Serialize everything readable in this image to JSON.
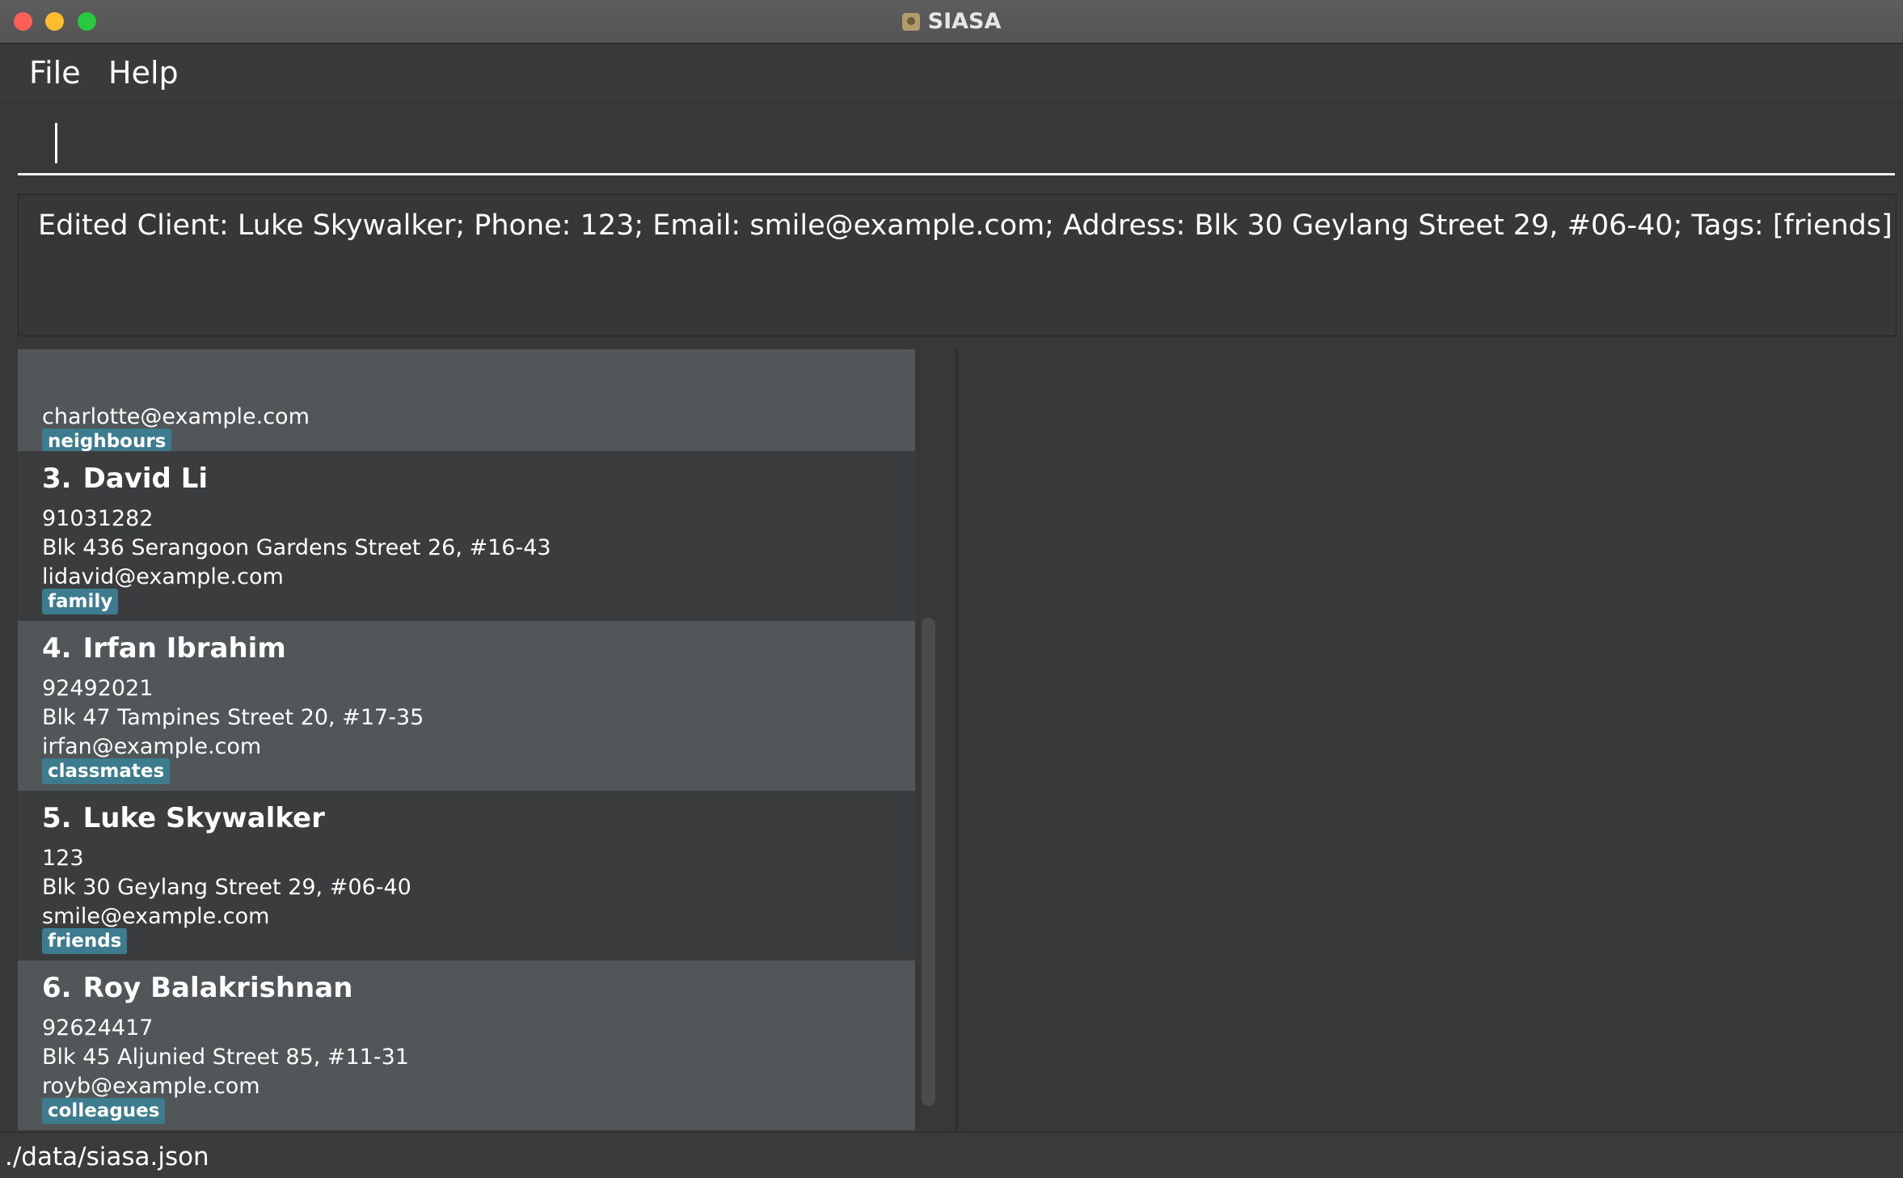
{
  "window": {
    "title": "SIASA",
    "icon": "app-icon"
  },
  "menu": {
    "file_label": "File",
    "help_label": "Help"
  },
  "command_box": {
    "value": "",
    "placeholder": ""
  },
  "result": {
    "text": "Edited Client: Luke Skywalker; Phone: 123; Email: smile@example.com; Address: Blk 30 Geylang Street 29, #06-40; Tags: [friends]"
  },
  "clients": [
    {
      "index": "",
      "name": "",
      "phone": "",
      "address": "",
      "email": "charlotte@example.com",
      "tag": "neighbours"
    },
    {
      "index": "3.",
      "name": "David Li",
      "phone": "91031282",
      "address": "Blk 436 Serangoon Gardens Street 26, #16-43",
      "email": "lidavid@example.com",
      "tag": "family"
    },
    {
      "index": "4.",
      "name": "Irfan Ibrahim",
      "phone": "92492021",
      "address": "Blk 47 Tampines Street 20, #17-35",
      "email": "irfan@example.com",
      "tag": "classmates"
    },
    {
      "index": "5.",
      "name": "Luke Skywalker",
      "phone": "123",
      "address": "Blk 30 Geylang Street 29, #06-40",
      "email": "smile@example.com",
      "tag": "friends"
    },
    {
      "index": "6.",
      "name": "Roy Balakrishnan",
      "phone": "92624417",
      "address": "Blk 45 Aljunied Street 85, #11-31",
      "email": "royb@example.com",
      "tag": "colleagues"
    }
  ],
  "status": {
    "file_path": "./data/siasa.json"
  },
  "colors": {
    "tag_bg": "#3d7b8f",
    "card_light": "#515658",
    "card_dark": "#3b3c3e",
    "background": "#383838"
  }
}
